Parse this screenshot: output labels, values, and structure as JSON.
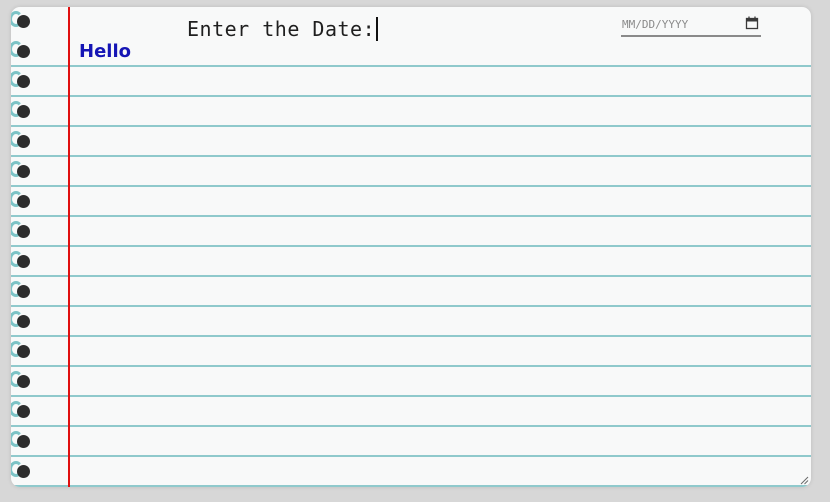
{
  "prompt": {
    "label": "Enter the Date:"
  },
  "date_field": {
    "placeholder": "MM/DD/YYYY",
    "icon": "calendar-icon"
  },
  "note": {
    "text": "Hello"
  },
  "colors": {
    "paper": "#f8f9f9",
    "rule_line": "#8fc9cc",
    "margin_line": "#e01010",
    "note_text": "#1515b5",
    "ring_hole": "#2d2d2d",
    "ring_hook": "#7cc3c6"
  }
}
